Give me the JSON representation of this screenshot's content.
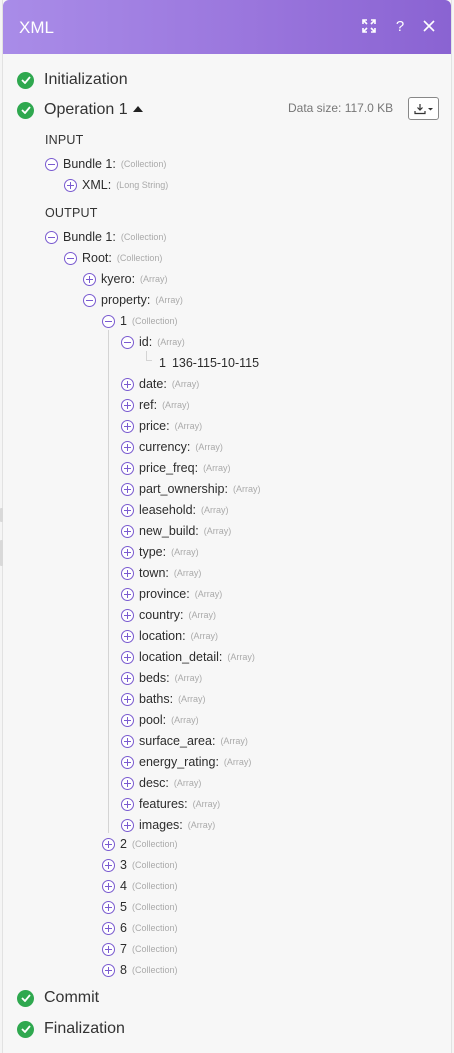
{
  "header": {
    "title": "XML"
  },
  "stages": {
    "initialization": "Initialization",
    "operation": "Operation 1",
    "commit": "Commit",
    "finalization": "Finalization"
  },
  "data_size": "Data size: 117.0 KB",
  "input": {
    "label": "INPUT",
    "bundle_key": "Bundle 1:",
    "bundle_type": "(Collection)",
    "xml_key": "XML:",
    "xml_type": "(Long String)"
  },
  "output": {
    "label": "OUTPUT",
    "bundle_key": "Bundle 1:",
    "bundle_type": "(Collection)",
    "root_key": "Root:",
    "root_type": "(Collection)",
    "kyero_key": "kyero:",
    "kyero_type": "(Array)",
    "property_key": "property:",
    "property_type": "(Array)",
    "item1_index": "1",
    "item1_type": "(Collection)",
    "id_key": "id:",
    "id_type": "(Array)",
    "id_value_index": "1",
    "id_value": "136-115-10-115",
    "fields": [
      {
        "key": "date:",
        "type": "(Array)"
      },
      {
        "key": "ref:",
        "type": "(Array)"
      },
      {
        "key": "price:",
        "type": "(Array)"
      },
      {
        "key": "currency:",
        "type": "(Array)"
      },
      {
        "key": "price_freq:",
        "type": "(Array)"
      },
      {
        "key": "part_ownership:",
        "type": "(Array)"
      },
      {
        "key": "leasehold:",
        "type": "(Array)"
      },
      {
        "key": "new_build:",
        "type": "(Array)"
      },
      {
        "key": "type:",
        "type": "(Array)"
      },
      {
        "key": "town:",
        "type": "(Array)"
      },
      {
        "key": "province:",
        "type": "(Array)"
      },
      {
        "key": "country:",
        "type": "(Array)"
      },
      {
        "key": "location:",
        "type": "(Array)"
      },
      {
        "key": "location_detail:",
        "type": "(Array)"
      },
      {
        "key": "beds:",
        "type": "(Array)"
      },
      {
        "key": "baths:",
        "type": "(Array)"
      },
      {
        "key": "pool:",
        "type": "(Array)"
      },
      {
        "key": "surface_area:",
        "type": "(Array)"
      },
      {
        "key": "energy_rating:",
        "type": "(Array)"
      },
      {
        "key": "desc:",
        "type": "(Array)"
      },
      {
        "key": "features:",
        "type": "(Array)"
      },
      {
        "key": "images:",
        "type": "(Array)"
      }
    ],
    "collections": [
      {
        "index": "2",
        "type": "(Collection)"
      },
      {
        "index": "3",
        "type": "(Collection)"
      },
      {
        "index": "4",
        "type": "(Collection)"
      },
      {
        "index": "5",
        "type": "(Collection)"
      },
      {
        "index": "6",
        "type": "(Collection)"
      },
      {
        "index": "7",
        "type": "(Collection)"
      },
      {
        "index": "8",
        "type": "(Collection)"
      }
    ]
  },
  "colors": {
    "accent": "#8a63d2",
    "success": "#2fa84f"
  }
}
